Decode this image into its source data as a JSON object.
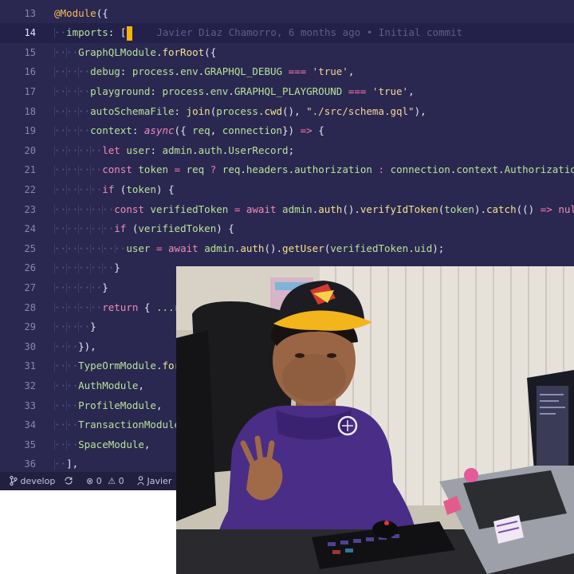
{
  "editor": {
    "lines": [
      {
        "n": "13",
        "tokens": [
          [
            "k",
            "@Module"
          ],
          [
            "p",
            "({"
          ]
        ]
      },
      {
        "n": "14",
        "tokens": [
          [
            "ws",
            "··"
          ],
          [
            "v",
            "imports"
          ],
          [
            "p",
            ": "
          ],
          [
            "p",
            "["
          ]
        ],
        "cursor": true,
        "blame": "Javier Diaz Chamorro, 6 months ago • Initial commit"
      },
      {
        "n": "15",
        "tokens": [
          [
            "ws",
            "····"
          ],
          [
            "v",
            "GraphQLModule"
          ],
          [
            "p",
            "."
          ],
          [
            "f",
            "forRoot"
          ],
          [
            "p",
            "({"
          ]
        ]
      },
      {
        "n": "16",
        "tokens": [
          [
            "ws",
            "······"
          ],
          [
            "v",
            "debug"
          ],
          [
            "p",
            ": "
          ],
          [
            "v",
            "process"
          ],
          [
            "p",
            "."
          ],
          [
            "v",
            "env"
          ],
          [
            "p",
            "."
          ],
          [
            "v",
            "GRAPHQL_DEBUG"
          ],
          [
            "p",
            " "
          ],
          [
            "op",
            "==="
          ],
          [
            "p",
            " "
          ],
          [
            "s",
            "'true'"
          ],
          [
            "p",
            ","
          ]
        ]
      },
      {
        "n": "17",
        "tokens": [
          [
            "ws",
            "······"
          ],
          [
            "v",
            "playground"
          ],
          [
            "p",
            ": "
          ],
          [
            "v",
            "process"
          ],
          [
            "p",
            "."
          ],
          [
            "v",
            "env"
          ],
          [
            "p",
            "."
          ],
          [
            "v",
            "GRAPHQL_PLAYGROUND"
          ],
          [
            "p",
            " "
          ],
          [
            "op",
            "==="
          ],
          [
            "p",
            " "
          ],
          [
            "s",
            "'true'"
          ],
          [
            "p",
            ","
          ]
        ]
      },
      {
        "n": "18",
        "tokens": [
          [
            "ws",
            "······"
          ],
          [
            "v",
            "autoSchemaFile"
          ],
          [
            "p",
            ": "
          ],
          [
            "f",
            "join"
          ],
          [
            "p",
            "("
          ],
          [
            "v",
            "process"
          ],
          [
            "p",
            "."
          ],
          [
            "f",
            "cwd"
          ],
          [
            "p",
            "(), "
          ],
          [
            "s",
            "\"./src/schema.gql\""
          ],
          [
            "p",
            "),"
          ]
        ]
      },
      {
        "n": "19",
        "tokens": [
          [
            "ws",
            "······"
          ],
          [
            "v",
            "context"
          ],
          [
            "p",
            ": "
          ],
          [
            "it",
            "async"
          ],
          [
            "p",
            "({ "
          ],
          [
            "v",
            "req"
          ],
          [
            "p",
            ", "
          ],
          [
            "v",
            "connection"
          ],
          [
            "p",
            "}) "
          ],
          [
            "op",
            "=>"
          ],
          [
            "p",
            " {"
          ]
        ]
      },
      {
        "n": "20",
        "tokens": [
          [
            "ws",
            "········"
          ],
          [
            "kw",
            "let"
          ],
          [
            "p",
            " "
          ],
          [
            "v",
            "user"
          ],
          [
            "p",
            ": "
          ],
          [
            "v",
            "admin"
          ],
          [
            "p",
            "."
          ],
          [
            "v",
            "auth"
          ],
          [
            "p",
            "."
          ],
          [
            "v",
            "UserRecord"
          ],
          [
            "p",
            ";"
          ]
        ]
      },
      {
        "n": "21",
        "tokens": [
          [
            "ws",
            "········"
          ],
          [
            "kw",
            "const"
          ],
          [
            "p",
            " "
          ],
          [
            "v",
            "token"
          ],
          [
            "p",
            " "
          ],
          [
            "op",
            "="
          ],
          [
            "p",
            " "
          ],
          [
            "v",
            "req"
          ],
          [
            "p",
            " "
          ],
          [
            "op",
            "?"
          ],
          [
            "p",
            " "
          ],
          [
            "v",
            "req"
          ],
          [
            "p",
            "."
          ],
          [
            "v",
            "headers"
          ],
          [
            "p",
            "."
          ],
          [
            "v",
            "authorization"
          ],
          [
            "p",
            " "
          ],
          [
            "op",
            ":"
          ],
          [
            "p",
            " "
          ],
          [
            "v",
            "connection"
          ],
          [
            "p",
            "."
          ],
          [
            "v",
            "context"
          ],
          [
            "p",
            "."
          ],
          [
            "v",
            "Authorization"
          ],
          [
            "p",
            ";"
          ]
        ]
      },
      {
        "n": "22",
        "tokens": [
          [
            "ws",
            "········"
          ],
          [
            "kw",
            "if"
          ],
          [
            "p",
            " ("
          ],
          [
            "v",
            "token"
          ],
          [
            "p",
            ") {"
          ]
        ]
      },
      {
        "n": "23",
        "tokens": [
          [
            "ws",
            "··········"
          ],
          [
            "kw",
            "const"
          ],
          [
            "p",
            " "
          ],
          [
            "v",
            "verifiedToken"
          ],
          [
            "p",
            " "
          ],
          [
            "op",
            "="
          ],
          [
            "p",
            " "
          ],
          [
            "kw",
            "await"
          ],
          [
            "p",
            " "
          ],
          [
            "v",
            "admin"
          ],
          [
            "p",
            "."
          ],
          [
            "f",
            "auth"
          ],
          [
            "p",
            "()."
          ],
          [
            "f",
            "verifyIdToken"
          ],
          [
            "p",
            "("
          ],
          [
            "v",
            "token"
          ],
          [
            "p",
            ")."
          ],
          [
            "f",
            "catch"
          ],
          [
            "p",
            "(() "
          ],
          [
            "op",
            "=>"
          ],
          [
            "p",
            " "
          ],
          [
            "kw",
            "null"
          ],
          [
            "p",
            ");"
          ]
        ]
      },
      {
        "n": "24",
        "tokens": [
          [
            "ws",
            "··········"
          ],
          [
            "kw",
            "if"
          ],
          [
            "p",
            " ("
          ],
          [
            "v",
            "verifiedToken"
          ],
          [
            "p",
            ") {"
          ]
        ]
      },
      {
        "n": "25",
        "tokens": [
          [
            "ws",
            "············"
          ],
          [
            "v",
            "user"
          ],
          [
            "p",
            " "
          ],
          [
            "op",
            "="
          ],
          [
            "p",
            " "
          ],
          [
            "kw",
            "await"
          ],
          [
            "p",
            " "
          ],
          [
            "v",
            "admin"
          ],
          [
            "p",
            "."
          ],
          [
            "f",
            "auth"
          ],
          [
            "p",
            "()."
          ],
          [
            "f",
            "getUser"
          ],
          [
            "p",
            "("
          ],
          [
            "v",
            "verifiedToken"
          ],
          [
            "p",
            "."
          ],
          [
            "v",
            "uid"
          ],
          [
            "p",
            ");"
          ]
        ]
      },
      {
        "n": "26",
        "tokens": [
          [
            "ws",
            "··········"
          ],
          [
            "p",
            "}"
          ]
        ]
      },
      {
        "n": "27",
        "tokens": [
          [
            "ws",
            "········"
          ],
          [
            "p",
            "}"
          ]
        ]
      },
      {
        "n": "28",
        "tokens": [
          [
            "ws",
            "········"
          ],
          [
            "kw",
            "return"
          ],
          [
            "p",
            " { "
          ],
          [
            "v",
            "...re"
          ]
        ]
      },
      {
        "n": "29",
        "tokens": [
          [
            "ws",
            "······"
          ],
          [
            "p",
            "}"
          ]
        ]
      },
      {
        "n": "30",
        "tokens": [
          [
            "ws",
            "····"
          ],
          [
            "p",
            "}),"
          ]
        ]
      },
      {
        "n": "31",
        "tokens": [
          [
            "ws",
            "····"
          ],
          [
            "v",
            "TypeOrmModule"
          ],
          [
            "p",
            "."
          ],
          [
            "f",
            "forRo"
          ]
        ]
      },
      {
        "n": "32",
        "tokens": [
          [
            "ws",
            "····"
          ],
          [
            "v",
            "AuthModule"
          ],
          [
            "p",
            ","
          ]
        ]
      },
      {
        "n": "33",
        "tokens": [
          [
            "ws",
            "····"
          ],
          [
            "v",
            "ProfileModule"
          ],
          [
            "p",
            ","
          ]
        ]
      },
      {
        "n": "34",
        "tokens": [
          [
            "ws",
            "····"
          ],
          [
            "v",
            "TransactionModule"
          ],
          [
            "p",
            ","
          ]
        ]
      },
      {
        "n": "35",
        "tokens": [
          [
            "ws",
            "····"
          ],
          [
            "v",
            "SpaceModule"
          ],
          [
            "p",
            ","
          ]
        ]
      },
      {
        "n": "36",
        "tokens": [
          [
            "ws",
            "··"
          ],
          [
            "p",
            "],"
          ]
        ]
      }
    ]
  },
  "statusbar": {
    "branch_icon": "git-branch-icon",
    "branch": "develop",
    "sync_icon": "sync-icon",
    "errors_icon": "error-icon",
    "errors": "0",
    "warnings_icon": "warning-icon",
    "warnings": "0",
    "author_icon": "person-icon",
    "author": "Javier"
  },
  "colors": {
    "editor_bg": "#2a2850",
    "active_line": "#23214a",
    "cursor": "#f4b400",
    "hoodie": "#4a2d86",
    "cap_yellow": "#f2b51c"
  }
}
